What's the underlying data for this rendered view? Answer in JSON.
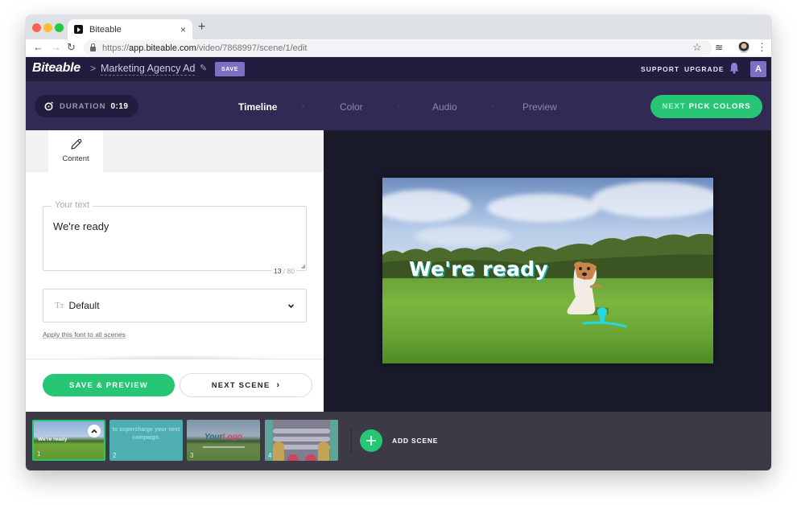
{
  "browser": {
    "tab_title": "Biteable",
    "new_tab_label": "+",
    "close_tab_label": "×",
    "url_scheme": "https://",
    "url_host": "app.biteable.com",
    "url_path": "/video/7868997/scene/1/edit"
  },
  "header": {
    "logo": "Biteable",
    "breadcrumb_sep": ">",
    "project_name": "Marketing Agency Ad",
    "save_label": "SAVE",
    "support_label": "SUPPORT",
    "upgrade_label": "UPGRADE",
    "avatar_initial": "A"
  },
  "steps": {
    "duration_label": "DURATION",
    "duration_value": "0:19",
    "items": [
      {
        "label": "Timeline",
        "active": true
      },
      {
        "label": "Color",
        "active": false
      },
      {
        "label": "Audio",
        "active": false
      },
      {
        "label": "Preview",
        "active": false
      }
    ],
    "separator": "›",
    "next_prefix": "NEXT",
    "next_label": "PICK COLORS"
  },
  "editor": {
    "tab_label": "Content",
    "text_field_label": "Your text",
    "text_value": "We're ready",
    "char_count": "13",
    "char_max": "/ 80",
    "font_icon": "Tт",
    "font_value": "Default",
    "apply_font_link": "Apply this font to all scenes",
    "save_preview_label": "SAVE & PREVIEW",
    "next_scene_label": "NEXT SCENE",
    "next_scene_chevron": "›"
  },
  "preview": {
    "headline": "We're ready"
  },
  "scenes": {
    "items": [
      {
        "number": "1",
        "caption": "We're ready",
        "selected": true
      },
      {
        "number": "2",
        "caption": "to supercharge your next campaign.",
        "selected": false
      },
      {
        "number": "3",
        "caption_a": "Your",
        "caption_b": "Logo",
        "selected": false
      },
      {
        "number": "4",
        "selected": false
      }
    ],
    "add_scene_label": "ADD SCENE"
  },
  "colors": {
    "brand_dark": "#241c3f",
    "steps_bg": "#322a55",
    "accent_green": "#26c675",
    "accent_purple": "#7e6fc5"
  }
}
